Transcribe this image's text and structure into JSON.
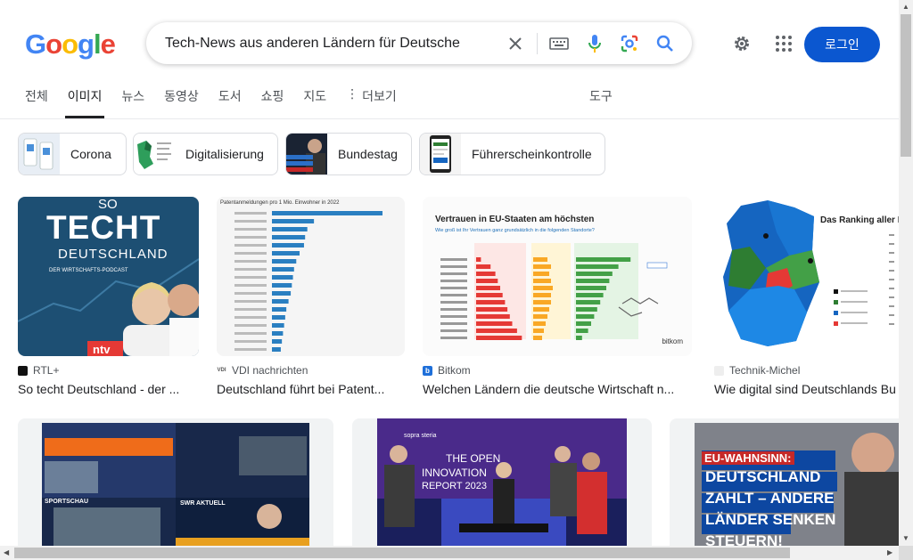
{
  "logo": [
    "G",
    "o",
    "o",
    "g",
    "l",
    "e"
  ],
  "logo_colors": [
    "#4285f4",
    "#ea4335",
    "#fbbc05",
    "#4285f4",
    "#34a853",
    "#ea4335"
  ],
  "search": {
    "value": "Tech-News aus anderen Ländern für Deutsche"
  },
  "header": {
    "login_label": "로그인"
  },
  "tabs": [
    "전체",
    "이미지",
    "뉴스",
    "동영상",
    "도서",
    "쇼핑",
    "지도"
  ],
  "tab_more": "더보기",
  "tools_label": "도구",
  "chips": [
    "Corona",
    "Digitalisierung",
    "Bundestag",
    "Führerscheinkontrolle"
  ],
  "results": [
    {
      "source": "RTL+",
      "title": "So techt Deutschland - der ..."
    },
    {
      "source": "VDI nachrichten",
      "title": "Deutschland führt bei Patent..."
    },
    {
      "source": "Bitkom",
      "title": "Welchen Ländern die deutsche Wirtschaft n..."
    },
    {
      "source": "Technik-Michel",
      "title": "Wie digital sind Deutschlands Bu"
    }
  ],
  "thumb_text": {
    "rtl_so": "SO",
    "rtl_techt": "TECHT",
    "rtl_deutschland": "DEUTSCHLAND",
    "rtl_podcast": "DER WIRTSCHAFTS-PODCAST",
    "rtl_logo": "ntv",
    "vdi_heading": "Patentanmeldungen pro 1 Mio. Einwohner in 2022",
    "bitkom_heading": "Vertrauen in EU-Staaten am höchsten",
    "bitkom_sub": "Wie groß ist Ihr Vertrauen ganz grundsätzlich in die folgenden Standorte?",
    "bitkom_logo": "bitkom",
    "map_heading": "Das Ranking aller B",
    "innovation_line1": "THE OPEN",
    "innovation_line2": "INNOVATION",
    "innovation_line3": "REPORT 2023",
    "innovation_brand": "sopra steria",
    "eu_tag": "EU-WAHNSINN:",
    "eu_line1": "DEUTSCHLAND",
    "eu_line2": "ZAHLT – ANDERE",
    "eu_line3": "LÄNDER SENKEN",
    "eu_line4": "STEUERN!",
    "news_brand": "SPORTSCHAU",
    "news_swr": "SWR AKTUELL"
  }
}
